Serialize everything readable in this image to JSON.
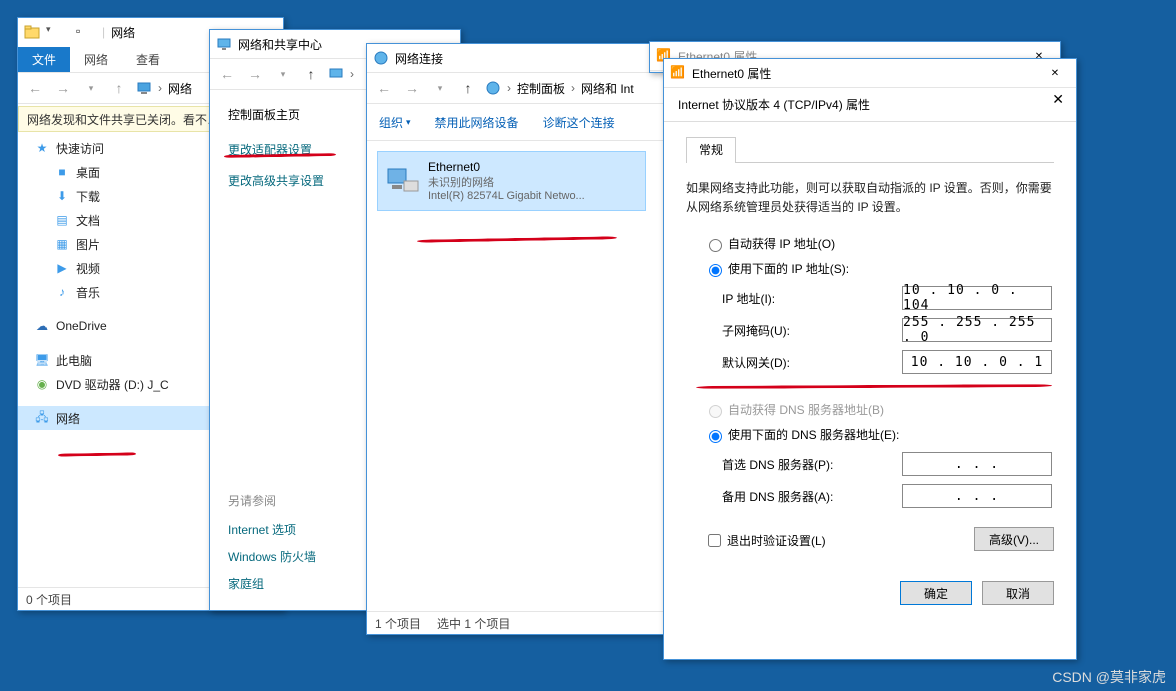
{
  "explorer": {
    "title": "网络",
    "ribbon": {
      "file": "文件",
      "network": "网络",
      "view": "查看"
    },
    "breadcrumb": [
      "网络"
    ],
    "yellow_notice": "网络发现和文件共享已关闭。看不…",
    "tree": {
      "quick_access": "快速访问",
      "desktop": "桌面",
      "downloads": "下载",
      "documents": "文档",
      "pictures": "图片",
      "videos": "视频",
      "music": "音乐",
      "onedrive": "OneDrive",
      "this_pc": "此电脑",
      "dvd": "DVD 驱动器 (D:) J_C",
      "network": "网络"
    },
    "status": "0 个项目"
  },
  "sharing_center": {
    "title": "网络和共享中心",
    "panel_header": "控制面板主页",
    "link1": "更改适配器设置",
    "link2": "更改高级共享设置",
    "see_also": "另请参阅",
    "opt1": "Internet 选项",
    "opt2": "Windows 防火墙",
    "opt3": "家庭组"
  },
  "connections": {
    "title": "网络连接",
    "breadcrumb": [
      "控制面板",
      "网络和 Int"
    ],
    "toolbar": {
      "organize": "组织",
      "disable": "禁用此网络设备",
      "diagnose": "诊断这个连接"
    },
    "card": {
      "name": "Ethernet0",
      "status": "未识别的网络",
      "adapter": "Intel(R) 82574L Gigabit Netwo..."
    },
    "status_left": "1 个项目",
    "status_right": "选中 1 个项目"
  },
  "eth_props": {
    "title": "Ethernet0 属性"
  },
  "ipv4": {
    "title": "Internet 协议版本 4 (TCP/IPv4) 属性",
    "tab": "常规",
    "desc": "如果网络支持此功能，则可以获取自动指派的 IP 设置。否则，你需要从网络系统管理员处获得适当的 IP 设置。",
    "auto_ip": "自动获得 IP 地址(O)",
    "manual_ip": "使用下面的 IP 地址(S):",
    "ip_label": "IP 地址(I):",
    "ip_value": "10 . 10 .  0 . 104",
    "mask_label": "子网掩码(U):",
    "mask_value": "255 . 255 . 255 .  0",
    "gw_label": "默认网关(D):",
    "gw_value": "10 . 10 .  0 .  1",
    "auto_dns": "自动获得 DNS 服务器地址(B)",
    "manual_dns": "使用下面的 DNS 服务器地址(E):",
    "dns1_label": "首选 DNS 服务器(P):",
    "dns1_value": ".       .       .",
    "dns2_label": "备用 DNS 服务器(A):",
    "dns2_value": ".       .       .",
    "validate": "退出时验证设置(L)",
    "advanced": "高级(V)...",
    "ok": "确定",
    "cancel": "取消"
  },
  "watermark": "CSDN @莫非家虎"
}
